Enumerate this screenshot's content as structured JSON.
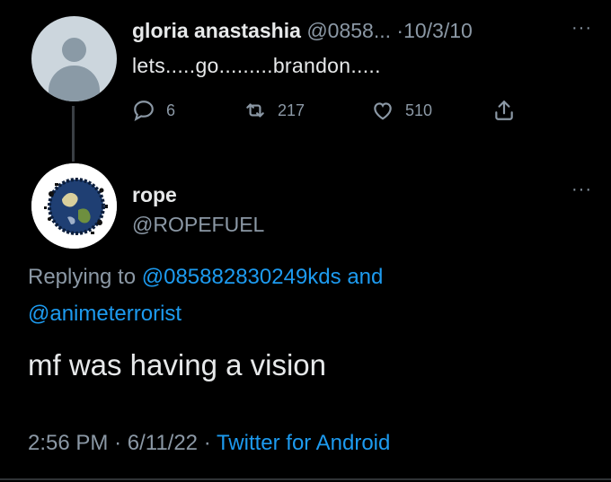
{
  "parent_tweet": {
    "display_name": "gloria anastashia",
    "handle": "@0858...",
    "separator": "·",
    "date": "10/3/10",
    "text": "lets.....go.........brandon.....",
    "replies": "6",
    "retweets": "217",
    "likes": "510",
    "more": "···"
  },
  "reply_tweet": {
    "display_name": "rope",
    "handle": "@ROPEFUEL",
    "more": "···",
    "replying_to_prefix": "Replying to",
    "replying_to_user1": "@085882830249kds",
    "replying_to_and": "and",
    "replying_to_user2": "@animeterrorist",
    "text": "mf was having a vision",
    "time": "2:56 PM",
    "meta_sep1": "·",
    "date": "6/11/22",
    "meta_sep2": "·",
    "source": "Twitter for Android"
  },
  "colors": {
    "background": "#000000",
    "text": "#e7e9ea",
    "muted": "#8b98a5",
    "link": "#1d9bf0"
  }
}
